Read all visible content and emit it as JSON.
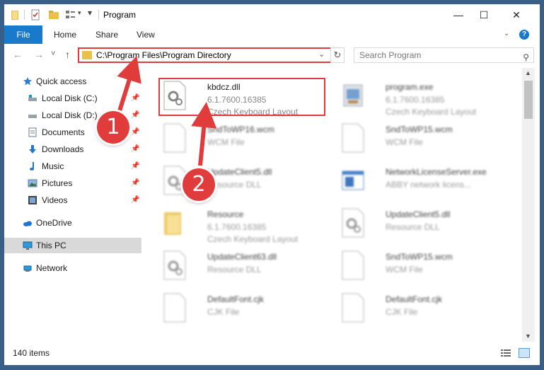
{
  "window": {
    "title": "Program",
    "controls": {
      "minimize": "—",
      "maximize": "☐",
      "close": "✕"
    }
  },
  "ribbon": {
    "tabs": [
      {
        "label": "File",
        "active": true
      },
      {
        "label": "Home"
      },
      {
        "label": "Share"
      },
      {
        "label": "View"
      }
    ],
    "help_label": "?"
  },
  "nav": {
    "back": "←",
    "forward": "→",
    "recent": "˅",
    "up": "↑",
    "address": "C:\\Program Files\\Program Directory",
    "refresh": "↻",
    "search_placeholder": "Search Program",
    "search_icon": "⚲"
  },
  "sidebar": {
    "items": [
      {
        "label": "Quick access",
        "icon": "star-icon",
        "pinned": false
      },
      {
        "label": "Local Disk (C:)",
        "icon": "drive-icon",
        "pinned": true
      },
      {
        "label": "Local Disk (D:)",
        "icon": "drive-icon",
        "pinned": true
      },
      {
        "label": "Documents",
        "icon": "documents-icon",
        "pinned": true
      },
      {
        "label": "Downloads",
        "icon": "download-icon",
        "pinned": true
      },
      {
        "label": "Music",
        "icon": "music-icon",
        "pinned": true
      },
      {
        "label": "Pictures",
        "icon": "pictures-icon",
        "pinned": true
      },
      {
        "label": "Videos",
        "icon": "videos-icon",
        "pinned": true
      },
      {
        "label": "OneDrive",
        "icon": "cloud-icon",
        "pinned": false
      },
      {
        "label": "This PC",
        "icon": "computer-icon",
        "pinned": false,
        "selected": true
      },
      {
        "label": "Network",
        "icon": "network-icon",
        "pinned": false
      }
    ],
    "pin_glyph": "📌"
  },
  "files": [
    {
      "name": "kbdcz.dll",
      "line1": "6.1.7600.16385",
      "line2": "Czech Keyboard Layout",
      "icon": "dll-gear-icon",
      "highlighted": true
    },
    {
      "name": "program.exe",
      "line1": "6.1.7600.16385",
      "line2": "Czech Keyboard Layout",
      "icon": "exe-icon"
    },
    {
      "name": "SndToWP16.wcm",
      "line1": "WCM File",
      "line2": "",
      "icon": "blank-file-icon"
    },
    {
      "name": "SndToWP15.wcm",
      "line1": "WCM File",
      "line2": "",
      "icon": "blank-file-icon"
    },
    {
      "name": "UpdateClient5.dll",
      "line1": "Resource DLL",
      "line2": "",
      "icon": "dll-gear-icon"
    },
    {
      "name": "NetworkLicenseServer.exe",
      "line1": "ABBY network licens...",
      "line2": "",
      "icon": "window-exe-icon"
    },
    {
      "name": "Resource",
      "line1": "6.1.7600.16385",
      "line2": "Czech Keyboard Layout",
      "icon": "folder-icon"
    },
    {
      "name": "UpdateClient5.dll",
      "line1": "Resource DLL",
      "line2": "",
      "icon": "dll-gear-icon"
    },
    {
      "name": "UpdateClient63.dll",
      "line1": "Resource DLL",
      "line2": "",
      "icon": "dll-gear-icon"
    },
    {
      "name": "SndToWP15.wcm",
      "line1": "WCM File",
      "line2": "",
      "icon": "blank-file-icon"
    },
    {
      "name": "DefaultFont.cjk",
      "line1": "CJK File",
      "line2": "",
      "icon": "blank-file-icon"
    },
    {
      "name": "DefaultFont.cjk",
      "line1": "CJK File",
      "line2": "",
      "icon": "blank-file-icon"
    }
  ],
  "status": {
    "count": "140 items"
  },
  "annotations": {
    "marker_1": "1",
    "marker_2": "2",
    "color": "#e03c3c"
  },
  "colors": {
    "accent": "#1979ca",
    "highlight": "#e03c3c",
    "folder": "#e9c04a"
  }
}
